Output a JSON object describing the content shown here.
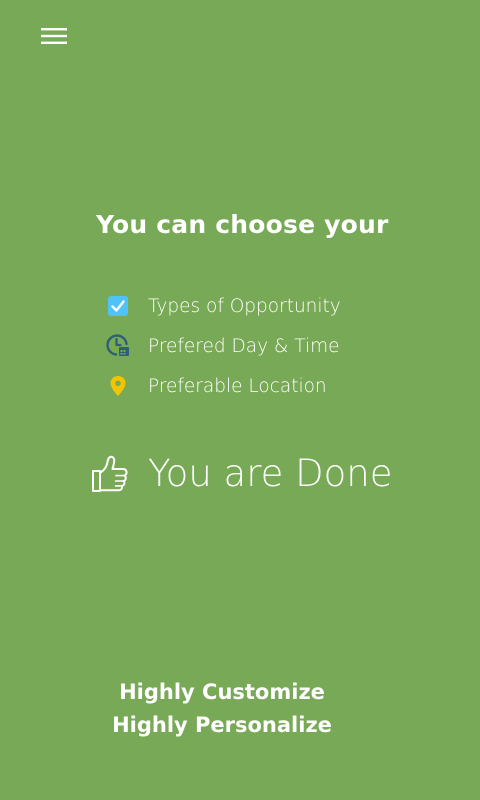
{
  "header": {
    "menu_icon": "hamburger-menu-icon"
  },
  "main": {
    "headline": "You can choose your",
    "features": [
      {
        "label": "Types of Opportunity",
        "icon": "checkbox-checked-icon",
        "icon_color": "#4fc3f7"
      },
      {
        "label": "Prefered Day & Time",
        "icon": "clock-calendar-icon",
        "icon_color": "#2e5f74"
      },
      {
        "label": "Preferable Location",
        "icon": "location-pin-icon",
        "icon_color": "#f5c400"
      }
    ],
    "done": {
      "label": "You are Done",
      "icon": "thumbs-up-icon"
    }
  },
  "footer": {
    "line1": "Highly Customize",
    "line2": "Highly Personalize"
  },
  "colors": {
    "background": "#78a956",
    "text": "#ffffff"
  }
}
